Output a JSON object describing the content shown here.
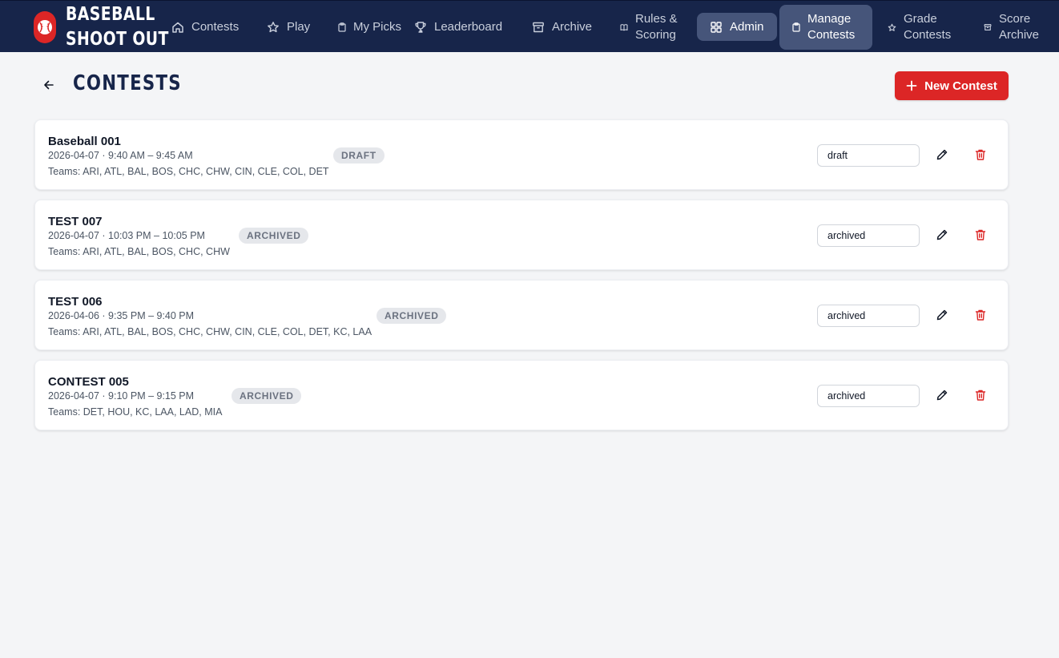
{
  "brand": {
    "line1": "BASEBALL",
    "line2": "SHOOT OUT"
  },
  "nav": {
    "contests": "Contests",
    "play": "Play",
    "my_picks": "My Picks",
    "leaderboard": "Leaderboard",
    "archive": "Archive",
    "rules": "Rules & Scoring",
    "admin": "Admin",
    "manage_contests": "Manage Contests",
    "grade_contests": "Grade Contests",
    "score_archive": "Score Archive"
  },
  "page": {
    "title": "CONTESTS",
    "new_button": "New Contest"
  },
  "contests": [
    {
      "name": "Baseball 001",
      "time": "2026-04-07 · 9:40 AM – 9:45 AM",
      "teams": "Teams: ARI, ATL, BAL, BOS, CHC, CHW, CIN, CLE, COL, DET",
      "badge": "DRAFT",
      "status": "draft"
    },
    {
      "name": "TEST 007",
      "time": "2026-04-07 · 10:03 PM – 10:05 PM",
      "teams": "Teams: ARI, ATL, BAL, BOS, CHC, CHW",
      "badge": "ARCHIVED",
      "status": "archived"
    },
    {
      "name": "TEST 006",
      "time": "2026-04-06 · 9:35 PM – 9:40 PM",
      "teams": "Teams: ARI, ATL, BAL, BOS, CHC, CHW, CIN, CLE, COL, DET, KC, LAA",
      "badge": "ARCHIVED",
      "status": "archived"
    },
    {
      "name": "CONTEST 005",
      "time": "2026-04-07 · 9:10 PM – 9:15 PM",
      "teams": "Teams: DET, HOU, KC, LAA, LAD, MIA",
      "badge": "ARCHIVED",
      "status": "archived"
    }
  ],
  "colors": {
    "nav_bg": "#17254a",
    "accent": "#dc2626",
    "nav_active": "#46557a",
    "page_bg": "#f4f5f7"
  }
}
